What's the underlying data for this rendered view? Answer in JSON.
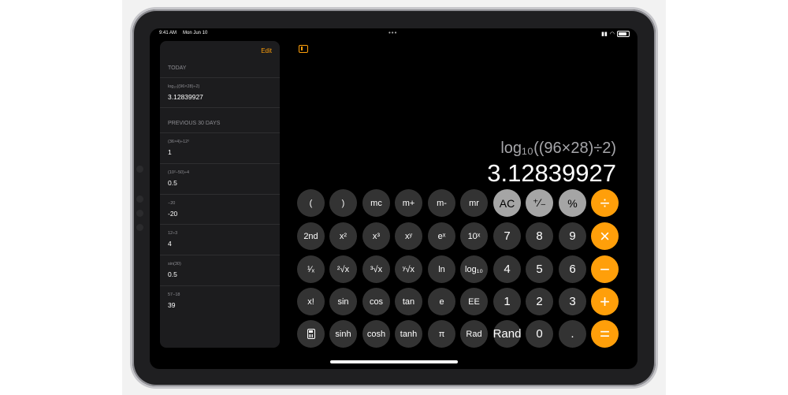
{
  "status": {
    "time": "9:41 AM",
    "date": "Mon Jun 10"
  },
  "history": {
    "edit_label": "Edit",
    "today_label": "TODAY",
    "previous_label": "PREVIOUS 30 DAYS",
    "today": [
      {
        "expression": "log₁₀((96×28)÷2)",
        "result": "3.12839927"
      }
    ],
    "previous": [
      {
        "expression": "(36×4)÷12²",
        "result": "1"
      },
      {
        "expression": "(10²−50)÷4",
        "result": "0.5"
      },
      {
        "expression": "−20",
        "result": "-20"
      },
      {
        "expression": "12÷3",
        "result": "4"
      },
      {
        "expression": "sin(30)",
        "result": "0.5"
      },
      {
        "expression": "57−18",
        "result": "39"
      }
    ]
  },
  "display": {
    "expression": "log₁₀((96×28)÷2)",
    "result": "3.12839927"
  },
  "keys": {
    "row1": [
      "(",
      ")",
      "mc",
      "m+",
      "m-",
      "mr",
      "AC",
      "⁺∕₋",
      "%",
      "÷"
    ],
    "row2": [
      "2nd",
      "x²",
      "x³",
      "xʸ",
      "eˣ",
      "10ˣ",
      "7",
      "8",
      "9",
      "×"
    ],
    "row3": [
      "¹∕ₓ",
      "²√x",
      "³√x",
      "ʸ√x",
      "ln",
      "log₁₀",
      "4",
      "5",
      "6",
      "−"
    ],
    "row4": [
      "x!",
      "sin",
      "cos",
      "tan",
      "e",
      "EE",
      "1",
      "2",
      "3",
      "+"
    ],
    "row5": [
      "",
      "sinh",
      "cosh",
      "tanh",
      "π",
      "Rad",
      "Rand",
      "0",
      ".",
      "="
    ]
  },
  "colors": {
    "operator": "#ff9f0a",
    "function": "#a5a5a5",
    "key": "#333333"
  }
}
